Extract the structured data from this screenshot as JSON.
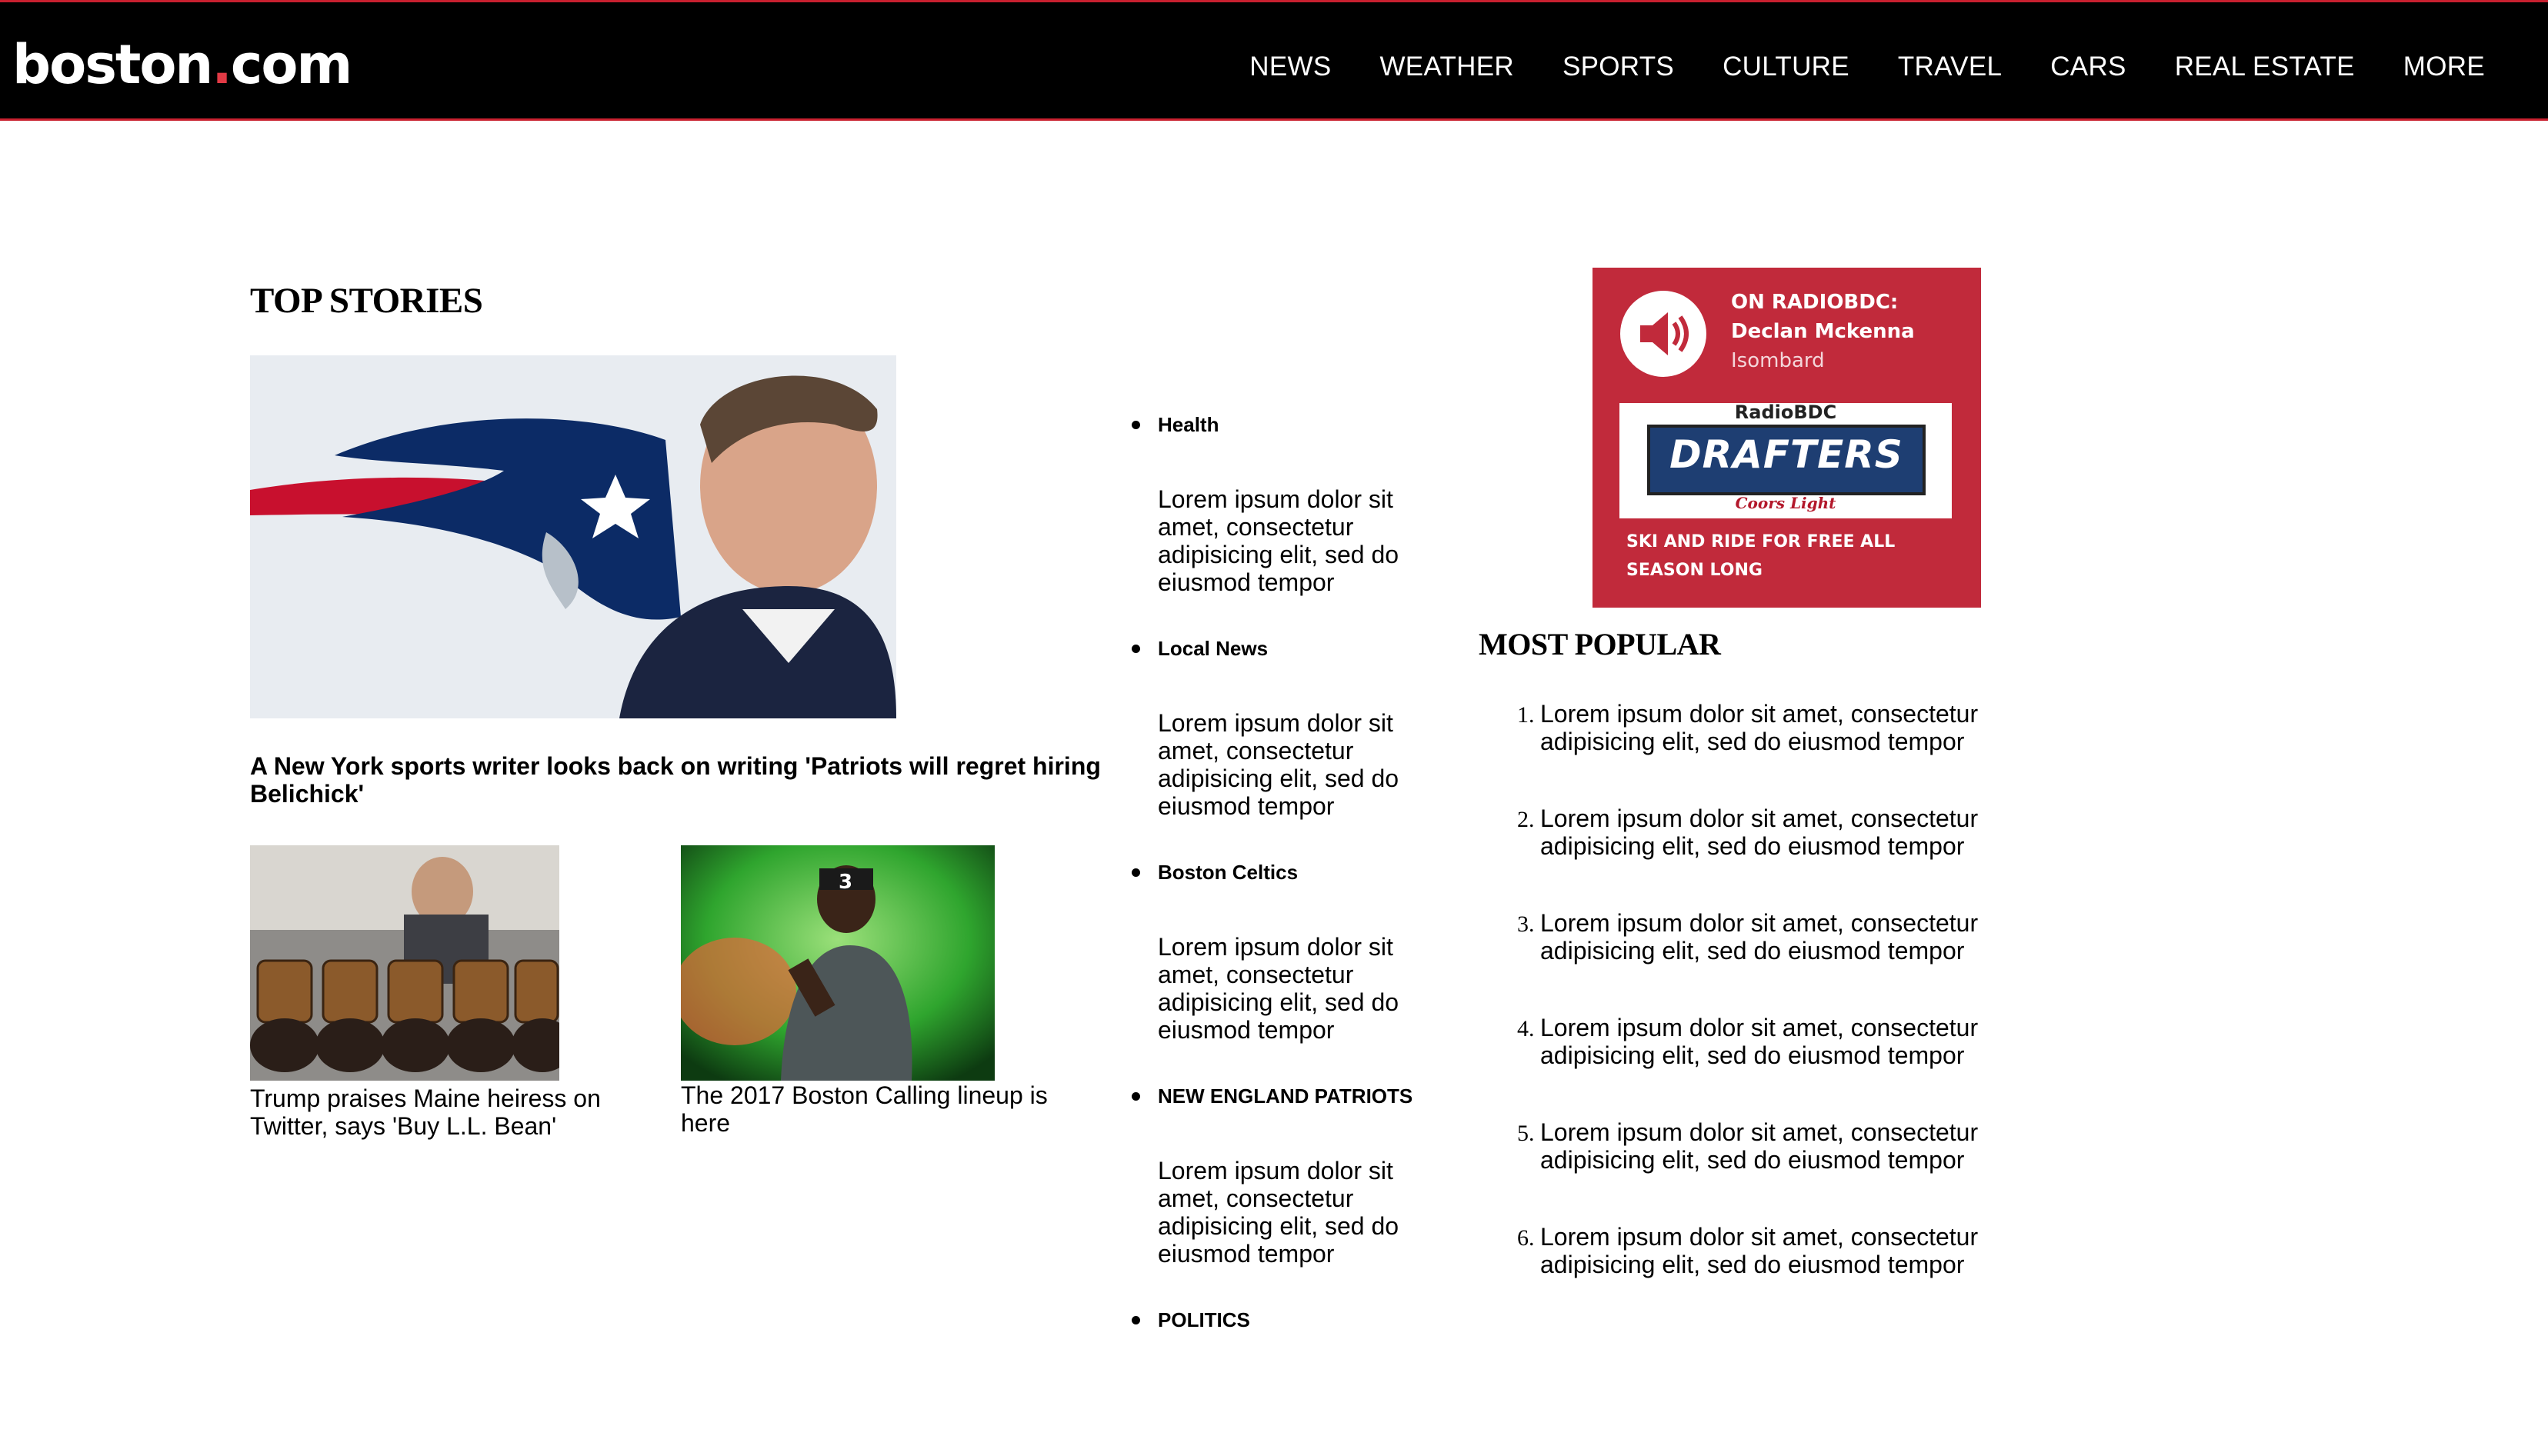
{
  "header": {
    "logo_main": "boston",
    "logo_dot": ".",
    "logo_tld": "com",
    "nav": [
      "NEWS",
      "WEATHER",
      "SPORTS",
      "CULTURE",
      "TRAVEL",
      "CARS",
      "REAL ESTATE",
      "MORE"
    ]
  },
  "top_stories": {
    "title": "TOP STORIES",
    "hero_headline": "A New York sports writer looks back on writing 'Patriots will regret hiring Belichick'",
    "secondary": [
      {
        "caption": "Trump praises Maine heiress on Twitter, says 'Buy L.L. Bean'"
      },
      {
        "caption": "The 2017 Boston Calling lineup is here"
      }
    ]
  },
  "categories": [
    {
      "label": "Health",
      "body": "Lorem ipsum dolor sit amet, consectetur adipisicing elit, sed do eiusmod tempor"
    },
    {
      "label": "Local News",
      "body": "Lorem ipsum dolor sit amet, consectetur adipisicing elit, sed do eiusmod tempor"
    },
    {
      "label": "Boston Celtics",
      "body": "Lorem ipsum dolor sit amet, consectetur adipisicing elit, sed do eiusmod tempor"
    },
    {
      "label": "NEW ENGLAND PATRIOTS",
      "body": "Lorem ipsum dolor sit amet, consectetur adipisicing elit, sed do eiusmod tempor"
    },
    {
      "label": "POLITICS",
      "body": ""
    }
  ],
  "ad": {
    "line1": "ON RADIOBDC:",
    "line2": "Declan Mckenna",
    "line3": "Isombard",
    "banner_top": "RadioBDC",
    "banner_title": "DRAFTERS",
    "banner_sub": "Coors Light",
    "footer": "SKI AND RIDE FOR FREE ALL SEASON LONG",
    "color": "#c12a3b"
  },
  "most_popular": {
    "title": "MOST POPULAR",
    "items": [
      "Lorem ipsum dolor sit amet, consectetur adipisicing elit, sed do eiusmod tempor",
      "Lorem ipsum dolor sit amet, consectetur adipisicing elit, sed do eiusmod tempor",
      "Lorem ipsum dolor sit amet, consectetur adipisicing elit, sed do eiusmod tempor",
      "Lorem ipsum dolor sit amet, consectetur adipisicing elit, sed do eiusmod tempor",
      "Lorem ipsum dolor sit amet, consectetur adipisicing elit, sed do eiusmod tempor",
      "Lorem ipsum dolor sit amet, consectetur adipisicing elit, sed do eiusmod tempor"
    ]
  }
}
